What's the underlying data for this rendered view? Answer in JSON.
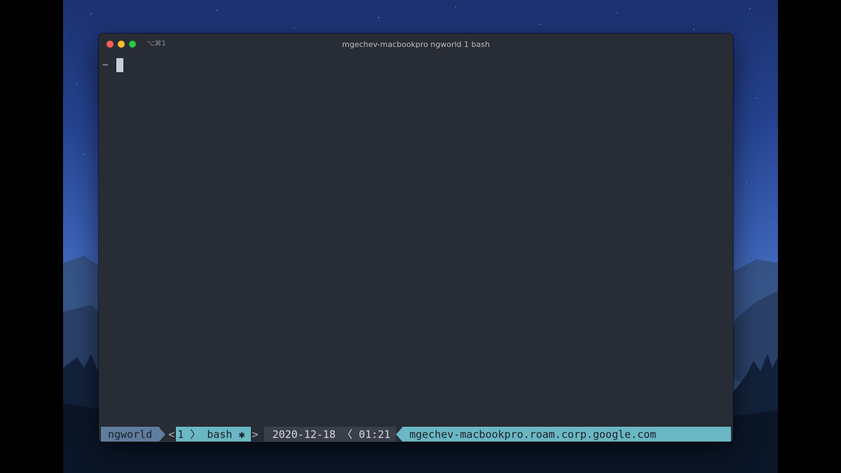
{
  "window": {
    "shortcut": "⌥⌘1",
    "title": "mgechev-macbookpro ngworld 1 bash"
  },
  "terminal": {
    "prompt": "~"
  },
  "status_bar": {
    "session": "ngworld",
    "window_open": "<",
    "window_index_name": "1 〉 bash ✱",
    "window_close": ">",
    "datetime": "2020-12-18 〈 01:21",
    "hostname": "mgechev-macbookpro.roam.corp.google.com"
  },
  "colors": {
    "terminal_bg": "#282c34",
    "session_bg": "#5f7d9e",
    "accent_cyan": "#6ab8c4",
    "close": "#ff5f57",
    "minimize": "#febc2e",
    "maximize": "#28c840"
  }
}
